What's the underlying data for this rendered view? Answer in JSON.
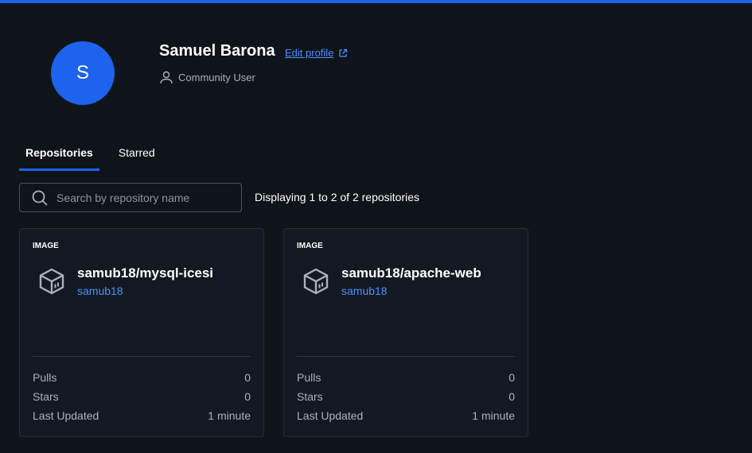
{
  "profile": {
    "avatar_initial": "S",
    "name": "Samuel Barona",
    "edit_label": "Edit profile",
    "role": "Community User"
  },
  "tabs": [
    {
      "label": "Repositories",
      "active": true
    },
    {
      "label": "Starred",
      "active": false
    }
  ],
  "search": {
    "placeholder": "Search by repository name",
    "value": ""
  },
  "display_text": "Displaying 1 to 2 of 2 repositories",
  "repositories": [
    {
      "kind": "IMAGE",
      "name": "samub18/mysql-icesi",
      "owner": "samub18",
      "stats": [
        {
          "label": "Pulls",
          "value": "0"
        },
        {
          "label": "Stars",
          "value": "0"
        },
        {
          "label": "Last Updated",
          "value": "1 minute"
        }
      ]
    },
    {
      "kind": "IMAGE",
      "name": "samub18/apache-web",
      "owner": "samub18",
      "stats": [
        {
          "label": "Pulls",
          "value": "0"
        },
        {
          "label": "Stars",
          "value": "0"
        },
        {
          "label": "Last Updated",
          "value": "1 minute"
        }
      ]
    }
  ],
  "colors": {
    "background": "#0f141b",
    "accent": "#1d63ed",
    "link": "#4d90fe",
    "muted_text": "#a9b1bd",
    "card_border": "#262d37"
  },
  "icons": {
    "role": "user-icon",
    "edit": "external-link-icon",
    "search": "search-icon",
    "repo": "cube-icon"
  }
}
